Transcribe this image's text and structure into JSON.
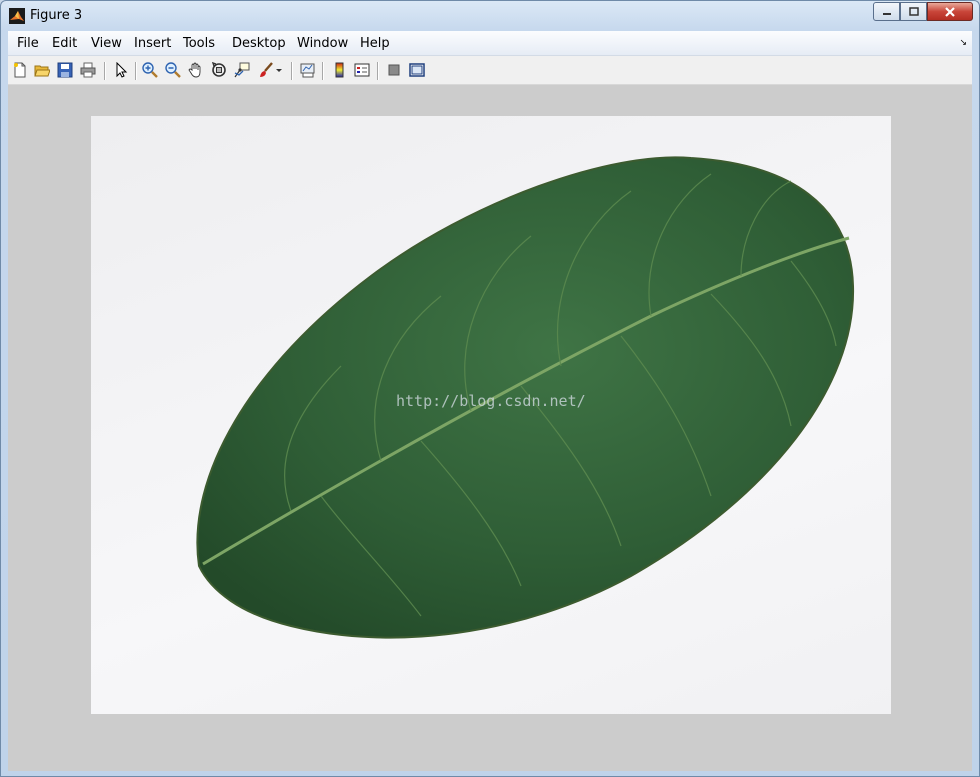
{
  "window": {
    "title": "Figure 3"
  },
  "menubar": {
    "items": [
      {
        "label": "File"
      },
      {
        "label": "Edit"
      },
      {
        "label": "View"
      },
      {
        "label": "Insert"
      },
      {
        "label": "Tools"
      },
      {
        "label": "Desktop"
      },
      {
        "label": "Window"
      },
      {
        "label": "Help"
      }
    ]
  },
  "toolbar": {
    "icons": [
      "new-figure-icon",
      "open-file-icon",
      "save-icon",
      "print-icon",
      "edit-plot-arrow-icon",
      "zoom-in-icon",
      "zoom-out-icon",
      "pan-hand-icon",
      "rotate-3d-icon",
      "data-cursor-icon",
      "brush-icon",
      "brush-dropdown-icon",
      "link-plot-icon",
      "colorbar-icon",
      "legend-icon",
      "hide-plot-tools-icon",
      "show-plot-tools-icon"
    ]
  },
  "figure": {
    "image_subject": "green leaf photo",
    "watermark": "http://blog.csdn.net/"
  },
  "colors": {
    "figure_background": "#cccccc",
    "leaf_dark": "#2f5a34",
    "leaf_mid": "#3f7445",
    "midrib": "#7da565"
  }
}
